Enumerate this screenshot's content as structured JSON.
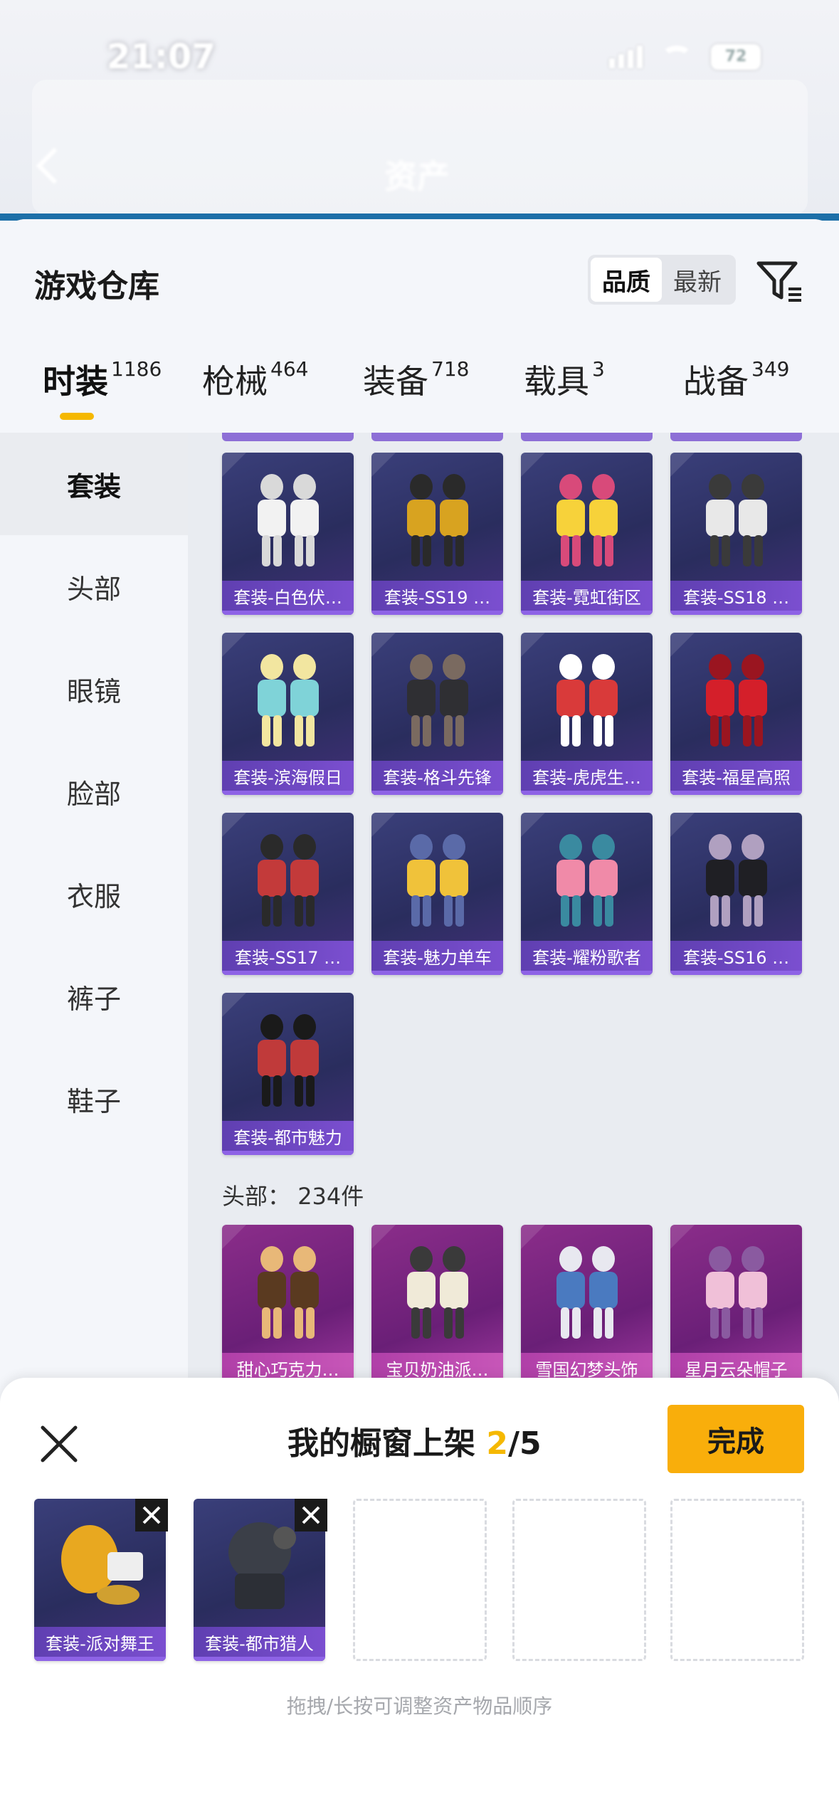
{
  "status": {
    "time": "21:07",
    "battery": "72"
  },
  "nav": {
    "title": "资产"
  },
  "header": {
    "title": "游戏仓库",
    "sort": [
      "品质",
      "最新"
    ],
    "sort_active": 0
  },
  "tabs": [
    {
      "label": "时装",
      "count": "1186"
    },
    {
      "label": "枪械",
      "count": "464"
    },
    {
      "label": "装备",
      "count": "718"
    },
    {
      "label": "载具",
      "count": "3"
    },
    {
      "label": "战备",
      "count": "349"
    }
  ],
  "sidebar": [
    "套装",
    "头部",
    "眼镜",
    "脸部",
    "衣服",
    "裤子",
    "鞋子"
  ],
  "suits": [
    "套装-白色伏…",
    "套装-SS19 …",
    "套装-霓虹街区",
    "套装-SS18 …",
    "套装-滨海假日",
    "套装-格斗先锋",
    "套装-虎虎生…",
    "套装-福星高照",
    "套装-SS17 …",
    "套装-魅力单车",
    "套装-耀粉歌者",
    "套装-SS16 …",
    "套装-都市魅力"
  ],
  "head_section": {
    "label": "头部：",
    "count": "234件"
  },
  "head_items": [
    "甜心巧克力…",
    "宝贝奶油派…",
    "雪国幻梦头饰",
    "星月云朵帽子"
  ],
  "panel": {
    "title": "我的橱窗上架",
    "current": "2",
    "total": "/5",
    "done_label": "完成",
    "slots": [
      "套装-派对舞王",
      "套装-都市猎人"
    ],
    "hint": "拖拽/长按可调整资产物品顺序"
  }
}
